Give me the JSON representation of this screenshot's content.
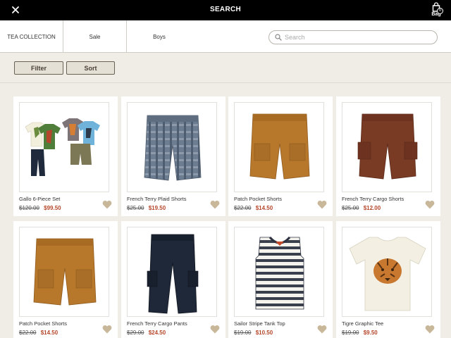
{
  "topbar": {
    "title": "SEARCH",
    "bag_label": "Bag",
    "bag_count": "0"
  },
  "nav": {
    "brand": "TEA COLLECTION",
    "sale": "Sale",
    "boys": "Boys"
  },
  "search": {
    "placeholder": "Search",
    "value": ""
  },
  "filters": {
    "filter_label": "Filter",
    "sort_label": "Sort"
  },
  "colors": {
    "sale_price": "#b5472b",
    "heart": "#c9b79a",
    "background": "#efede6"
  },
  "products": [
    {
      "name": "Gallo 6-Piece Set",
      "old_price": "$120.00",
      "price": "$99.50",
      "image": "outfit-set"
    },
    {
      "name": "French Terry Plaid Shorts",
      "old_price": "$25.00",
      "price": "$19.50",
      "image": "plaid-shorts"
    },
    {
      "name": "Patch Pocket Shorts",
      "old_price": "$22.00",
      "price": "$14.50",
      "image": "tan-shorts"
    },
    {
      "name": "French Terry Cargo Shorts",
      "old_price": "$25.00",
      "price": "$12.00",
      "image": "brown-cargo-shorts"
    },
    {
      "name": "Patch Pocket Shorts",
      "old_price": "$22.00",
      "price": "$14.50",
      "image": "tan-shorts"
    },
    {
      "name": "French Terry Cargo Pants",
      "old_price": "$29.00",
      "price": "$24.50",
      "image": "navy-pants"
    },
    {
      "name": "Sailor Stripe Tank Top",
      "old_price": "$19.00",
      "price": "$10.50",
      "image": "striped-tank"
    },
    {
      "name": "Tigre Graphic Tee",
      "old_price": "$19.00",
      "price": "$9.50",
      "image": "tiger-tee"
    }
  ]
}
